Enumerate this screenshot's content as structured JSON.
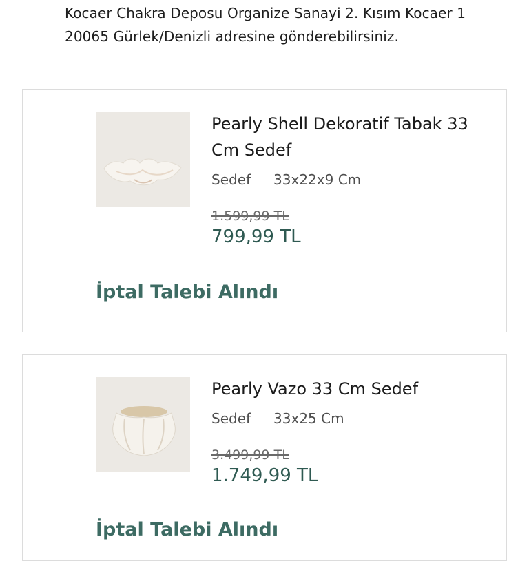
{
  "address_text": "Kocaer Chakra Deposu Organize Sanayi 2. Kısım Kocaer 1 20065 Gürlek/Denizli adresine gönderebilirsiniz.",
  "items": [
    {
      "title": "Pearly Shell Dekoratif Tabak 33 Cm Sedef",
      "color": "Sedef",
      "size": "33x22x9 Cm",
      "old_price": "1.599,99 TL",
      "price": "799,99 TL",
      "status": "İptal Talebi Alındı",
      "image": "pearl-shell-plate-icon"
    },
    {
      "title": "Pearly Vazo 33 Cm Sedef",
      "color": "Sedef",
      "size": "33x25 Cm",
      "old_price": "3.499,99 TL",
      "price": "1.749,99 TL",
      "status": "İptal Talebi Alındı",
      "image": "pearl-vase-icon"
    }
  ],
  "colors": {
    "price": "#2f5a52",
    "status": "#3d6b63",
    "card_border": "#dcdcdc",
    "thumb_bg": "#ece9e4"
  }
}
